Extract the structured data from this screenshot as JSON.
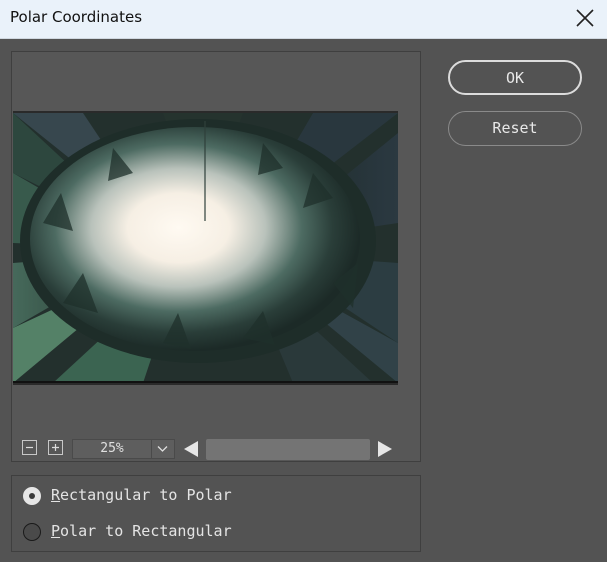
{
  "window": {
    "title": "Polar Coordinates"
  },
  "preview": {
    "zoom": {
      "value": "25%",
      "zoom_out_icon": "minus-icon",
      "zoom_in_icon": "plus-icon"
    }
  },
  "buttons": {
    "ok_label": "OK",
    "reset_label": "Reset"
  },
  "options": {
    "selected": "rectangular-to-polar",
    "items": [
      {
        "id": "rectangular-to-polar",
        "mnemonic": "R",
        "rest": "ectangular to Polar",
        "checked": true
      },
      {
        "id": "polar-to-rectangular",
        "mnemonic": "P",
        "rest": "olar to Rectangular",
        "checked": false
      }
    ]
  },
  "colors": {
    "dialog_bg": "#535353",
    "titlebar_bg": "#eaf2fa",
    "text": "#e4e4e4"
  }
}
